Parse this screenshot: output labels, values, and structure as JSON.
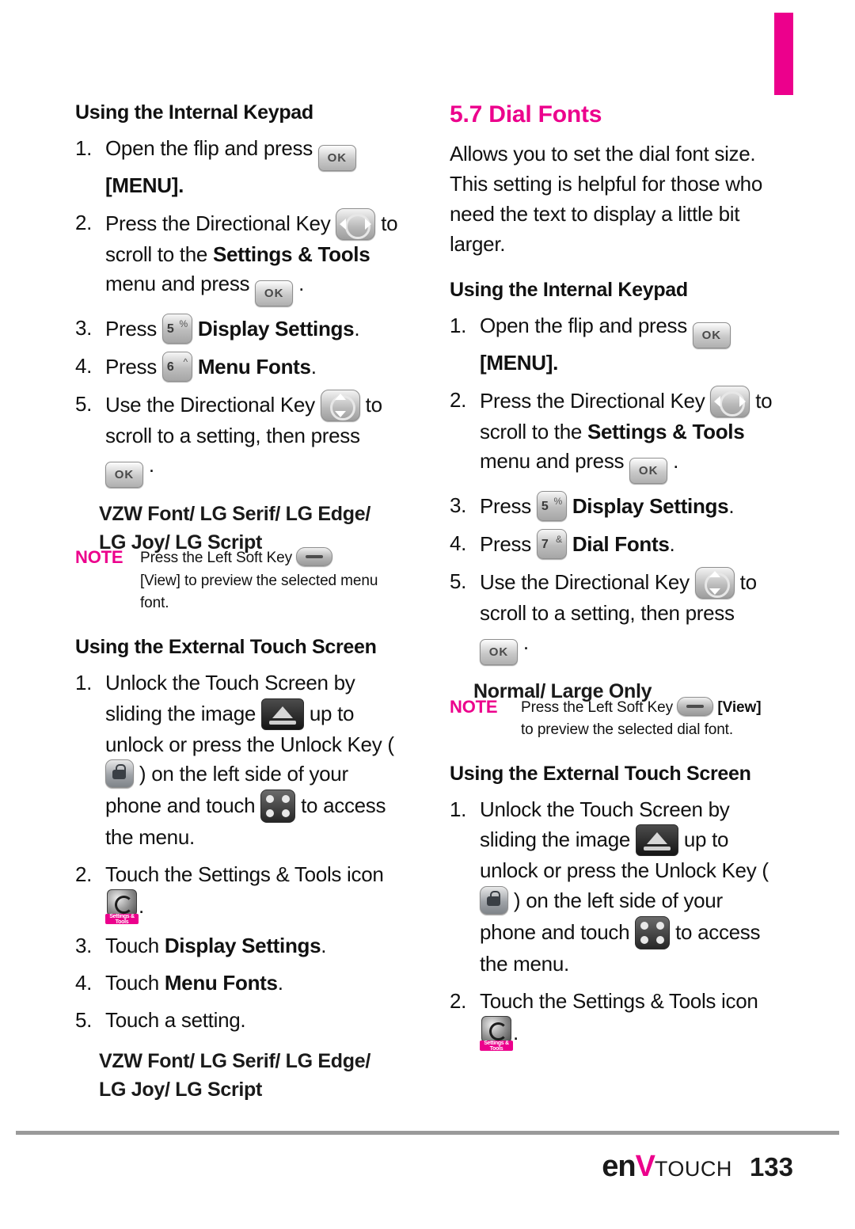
{
  "page": {
    "number": "133",
    "brand_en": "en",
    "brand_v": "V",
    "brand_touch": "TOUCH"
  },
  "left_column": {
    "heading_internal": "Using the Internal Keypad",
    "steps_internal": [
      {
        "num": "1.",
        "text_a": "Open the flip and press ",
        "key": "ok-key",
        "text_b": "",
        "bold_after": "[MENU]."
      },
      {
        "num": "2.",
        "text_a": "Press the Directional Key ",
        "key": "directional-key",
        "text_b": " to scroll to the ",
        "bold": "Settings & Tools",
        "text_c": " menu and press ",
        "key2": "ok-key",
        "text_d": " ."
      },
      {
        "num": "3.",
        "text_a": "Press ",
        "key": "num-key-5",
        "bold": "Display Settings",
        "text_b": "."
      },
      {
        "num": "4.",
        "text_a": "Press ",
        "key": "num-key-6",
        "bold": "Menu Fonts",
        "text_b": "."
      },
      {
        "num": "5.",
        "text_a": "Use the Directional Key ",
        "key": "directional-key",
        "text_b": " to scroll to a setting, then press ",
        "key2": "ok-key",
        "text_c": " ."
      }
    ],
    "fonts_line1": "VZW Font/ LG Serif/ LG Edge/",
    "fonts_line2": "LG Joy/ LG Script",
    "note_label": "NOTE",
    "note_text": "Press the Left Soft Key",
    "note_text2": "[View] to preview the selected menu font.",
    "heading_touch": "Using the External Touch Screen",
    "steps_touch": [
      {
        "num": "1.",
        "a": "Unlock the Touch Screen by sliding the image ",
        "b": " up to unlock or press the Unlock Key ( ",
        "c": " ) on the left side of your phone and touch ",
        "d": " to access the menu."
      },
      {
        "num": "2.",
        "a": "Touch the Settings & Tools icon ",
        "b": "."
      },
      {
        "num": "3.",
        "a": "Touch ",
        "bold": "Display Settings",
        "b": "."
      },
      {
        "num": "4.",
        "a": "Touch ",
        "bold": "Menu Fonts",
        "b": "."
      },
      {
        "num": "5.",
        "a": "Touch a setting.",
        "b": ""
      }
    ],
    "fonts2_line1": "VZW Font/ LG Serif/ LG Edge/",
    "fonts2_line2": "LG Joy/ LG Script"
  },
  "right_column": {
    "section_title": "5.7 Dial Fonts",
    "intro": "Allows you to set the dial font size. This setting is helpful for those who need the text to display a little bit larger.",
    "heading_internal": "Using the Internal Keypad",
    "steps_internal": [
      {
        "num": "1.",
        "text_a": "Open the flip and press ",
        "bold_after": "[MENU]."
      },
      {
        "num": "2.",
        "text_a": "Press the Directional Key ",
        "text_b": " to scroll to the ",
        "bold": "Settings & Tools",
        "text_c": " menu and press ",
        "text_d": " ."
      },
      {
        "num": "3.",
        "text_a": "Press ",
        "bold": "Display Settings",
        "text_b": "."
      },
      {
        "num": "4.",
        "text_a": "Press ",
        "bold": "Dial Fonts",
        "text_b": "."
      },
      {
        "num": "5.",
        "text_a": "Use the Directional Key ",
        "text_b": " to scroll to a setting, then press ",
        "text_c": " ."
      }
    ],
    "options_heading": "Normal/ Large Only",
    "note_label": "NOTE",
    "note_text": "Press the Left Soft Key",
    "note_text_bold": "[View]",
    "note_text2": "to preview the selected dial font.",
    "heading_touch": "Using the External Touch Screen",
    "steps_touch": [
      {
        "num": "1.",
        "a": "Unlock the Touch Screen by sliding the image ",
        "b": " up to unlock or press the Unlock Key ( ",
        "c": " ) on the left side of your phone and touch ",
        "d": " to access the menu."
      },
      {
        "num": "2.",
        "a": "Touch the Settings & Tools icon ",
        "b": "."
      }
    ]
  },
  "keys": {
    "ok_label": "OK",
    "num5_digit": "5",
    "num5_sub": "%",
    "num6_digit": "6",
    "num6_sub": "^",
    "num7_digit": "7",
    "num7_sub": "&",
    "settings_tools_caption": "Settings & Tools"
  },
  "colors": {
    "accent": "#ec008c",
    "text": "#111111",
    "rule": "#9a9a9a"
  }
}
